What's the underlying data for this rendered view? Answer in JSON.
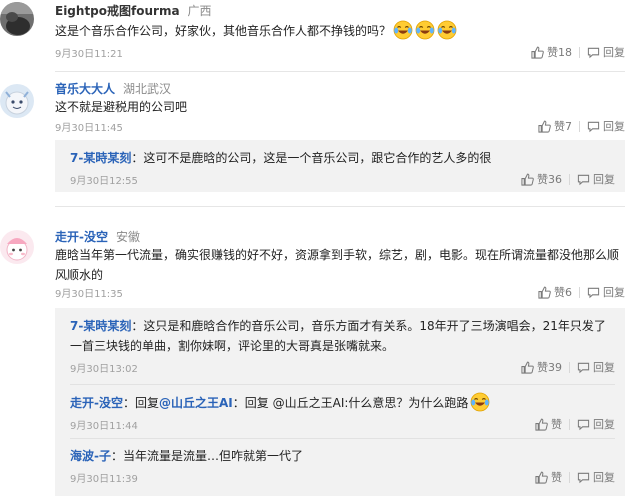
{
  "actions": {
    "like_label": "赞",
    "reply_label": "回复"
  },
  "comments": [
    {
      "user": "Eightpo戒图fourma",
      "location": "广西",
      "text": "这是个音乐合作公司，好家伙，其他音乐合作人都不挣钱的吗？",
      "emoji": [
        "laugh-cry",
        "laugh-cry",
        "laugh-cry"
      ],
      "time": "9月30日11:21",
      "likes": "18"
    },
    {
      "user": "音乐大大人",
      "location": "湖北武汉",
      "text": "这不就是避税用的公司吧",
      "time": "9月30日11:45",
      "likes": "7",
      "replies": [
        {
          "user": "7-某時某刻",
          "text": "这可不是鹿晗的公司，这是一个音乐公司，跟它合作的艺人多的很",
          "time": "9月30日12:55",
          "likes": "36"
        }
      ]
    },
    {
      "user": "走开-没空",
      "location": "安徽",
      "text": "鹿晗当年第一代流量，确实很赚钱的好不好，资源拿到手软，综艺，剧，电影。现在所谓流量都没他那么顺风顺水的",
      "time": "9月30日11:35",
      "likes": "6",
      "replies": [
        {
          "user": "7-某時某刻",
          "text": "这只是和鹿晗合作的音乐公司，音乐方面才有关系。18年开了三场演唱会，21年只发了一首三块钱的单曲，割你妹啊，评论里的大哥真是张嘴就来。",
          "time": "9月30日13:02",
          "likes": "39"
        },
        {
          "user": "走开-没空",
          "reply_prefix": "回复",
          "reply_target": "@山丘之王AI",
          "text": "回复 @山丘之王AI:什么意思？为什么跑路",
          "emoji": [
            "laugh-cry"
          ],
          "time": "9月30日11:44",
          "likes": ""
        },
        {
          "user": "海波-子",
          "text": "当年流量是流量…但咋就第一代了",
          "time": "9月30日11:39",
          "likes": ""
        }
      ]
    }
  ],
  "colors": {
    "link_blue": "#2a63b8",
    "reply_bg": "#f2f2f2",
    "meta_gray": "#a0a0a0"
  }
}
